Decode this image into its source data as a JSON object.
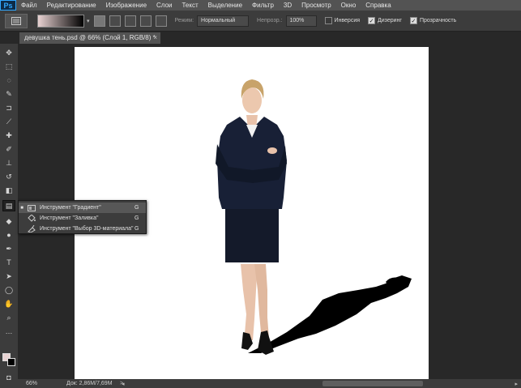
{
  "app": {
    "logo": "Ps",
    "colors": {
      "accent": "#31a8ff",
      "ui_dark": "#282828",
      "panel": "#3c3c3c",
      "menu": "#535353"
    }
  },
  "menu": {
    "items": [
      "Файл",
      "Редактирование",
      "Изображение",
      "Слои",
      "Текст",
      "Выделение",
      "Фильтр",
      "3D",
      "Просмотр",
      "Окно",
      "Справка"
    ]
  },
  "options": {
    "gradient_colors": [
      "#e8d2d2",
      "#000000"
    ],
    "mode_label": "Режим:",
    "mode_value": "Нормальный",
    "opacity_label": "Непрозр.:",
    "opacity_value": "100%",
    "inverse_label": "Инверсия",
    "inverse_checked": false,
    "dither_label": "Дизеринг",
    "dither_checked": true,
    "transparency_label": "Прозрачность",
    "transparency_checked": true
  },
  "document": {
    "tab_title": "девушка тень.psd @ 66% (Слой 1, RGB/8) *",
    "close_glyph": "×"
  },
  "flyout": {
    "items": [
      {
        "label": "Инструмент \"Градиент\"",
        "key": "G",
        "active": true,
        "icon": "gradient-icon"
      },
      {
        "label": "Инструмент \"Заливка\"",
        "key": "G",
        "active": false,
        "icon": "paint-bucket-icon"
      },
      {
        "label": "Инструмент \"Выбор 3D-материала\"",
        "key": "G",
        "active": false,
        "icon": "3d-material-drop-icon"
      }
    ]
  },
  "status": {
    "zoom": "66%",
    "doc_info": "Док: 2,86M/7,69M",
    "arrow": ">"
  },
  "toolbar": {
    "foreground_color": "#e8d2d2",
    "background_color": "#000000"
  }
}
